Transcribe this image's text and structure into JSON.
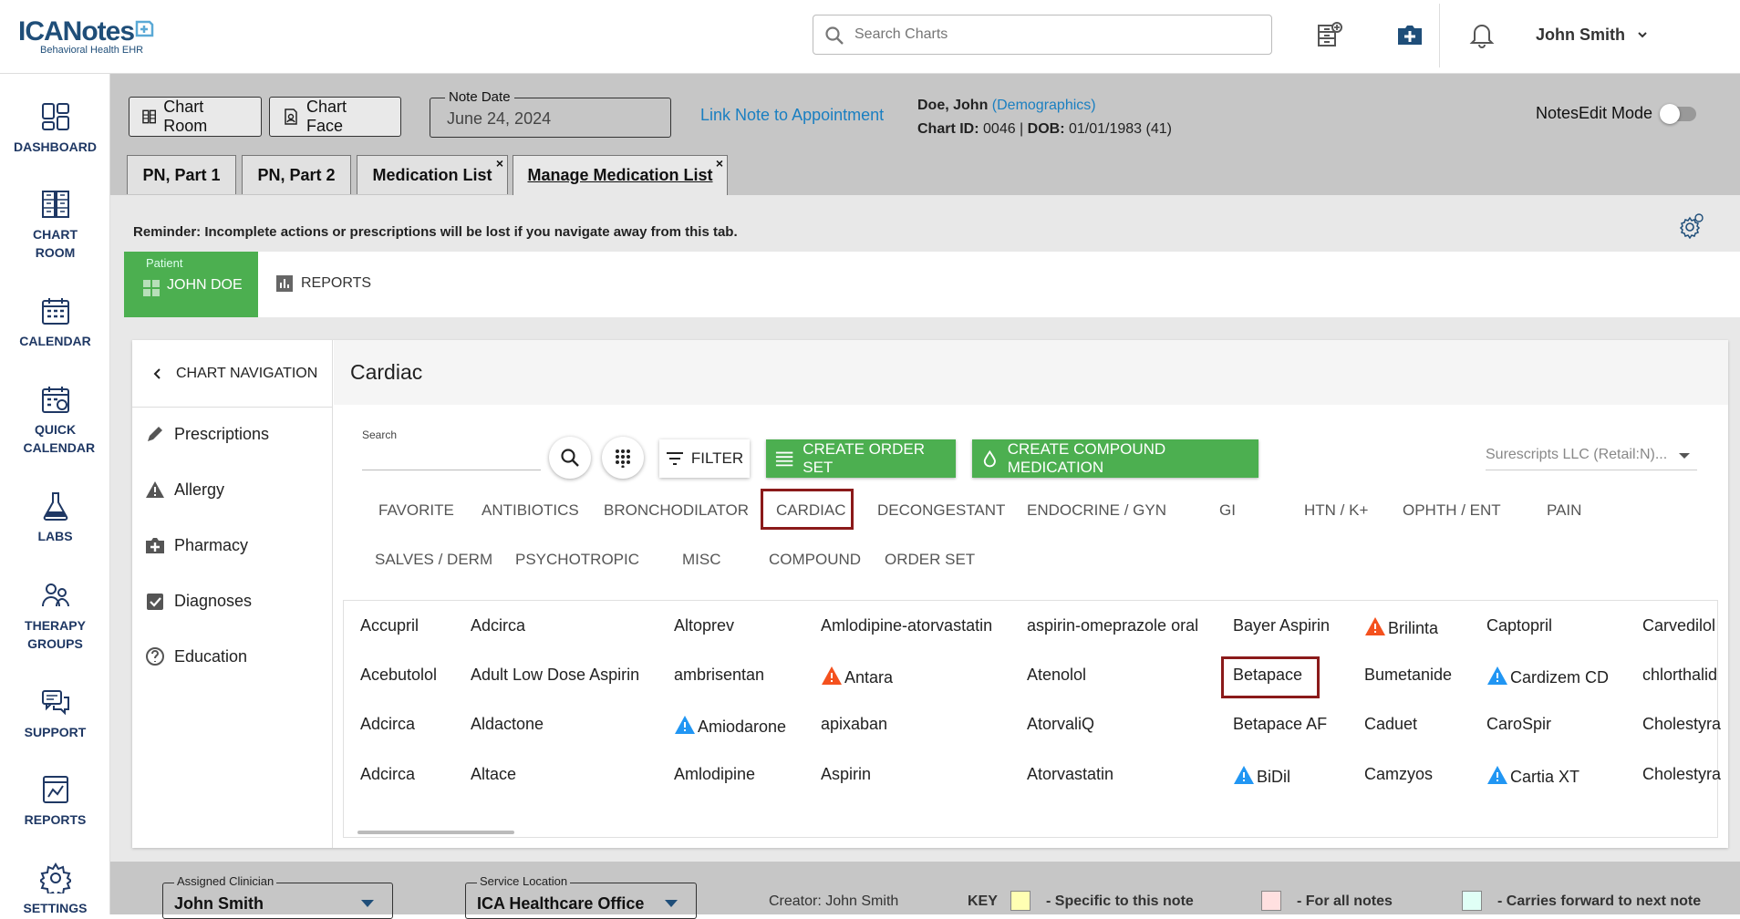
{
  "header": {
    "logo_main": "ICANotes",
    "logo_sub": "Behavioral Health EHR",
    "search_placeholder": "Search Charts",
    "user_name": "John Smith"
  },
  "sidebar": {
    "items": [
      {
        "label": "DASHBOARD"
      },
      {
        "label": "CHART ROOM"
      },
      {
        "label": "CALENDAR"
      },
      {
        "label": "QUICK CALENDAR"
      },
      {
        "label": "LABS"
      },
      {
        "label": "THERAPY GROUPS"
      },
      {
        "label": "SUPPORT"
      },
      {
        "label": "REPORTS"
      },
      {
        "label": "SETTINGS"
      }
    ]
  },
  "topbar": {
    "chart_room": "Chart Room",
    "chart_face": "Chart Face",
    "note_date_label": "Note Date",
    "note_date_value": "June 24, 2024",
    "link_note": "Link Note to Appointment",
    "patient_name": "Doe, John",
    "demographics": "(Demographics)",
    "chart_id_label": "Chart ID:",
    "chart_id": "0046",
    "dob_label": "DOB:",
    "dob": "01/01/1983 (41)",
    "notes_edit_mode": "NotesEdit Mode"
  },
  "tabs": [
    {
      "label": "PN, Part 1"
    },
    {
      "label": "PN, Part 2"
    },
    {
      "label": "Medication List",
      "close": "×"
    },
    {
      "label": "Manage Medication List",
      "close": "×"
    }
  ],
  "reminder": "Reminder: Incomplete actions or prescriptions will be lost if you navigate away from this tab.",
  "patient_tab": {
    "small": "Patient",
    "name": "JOHN DOE"
  },
  "reports_tab": "REPORTS",
  "chart_nav": {
    "header": "CHART NAVIGATION",
    "items": [
      {
        "label": "Prescriptions"
      },
      {
        "label": "Allergy"
      },
      {
        "label": "Pharmacy"
      },
      {
        "label": "Diagnoses"
      },
      {
        "label": "Education"
      }
    ]
  },
  "main": {
    "title": "Cardiac",
    "search_label": "Search",
    "filter_label": "FILTER",
    "create_order_set": "CREATE ORDER SET",
    "create_compound": "CREATE COMPOUND MEDICATION",
    "pharmacy_select": "Surescripts LLC (Retail:N)...",
    "categories_row1": [
      "FAVORITE",
      "ANTIBIOTICS",
      "BRONCHODILATOR",
      "CARDIAC",
      "DECONGESTANT",
      "ENDOCRINE / GYN",
      "GI",
      "HTN / K+",
      "OPHTH / ENT",
      "PAIN"
    ],
    "categories_row2": [
      "SALVES / DERM",
      "PSYCHOTROPIC",
      "MISC",
      "COMPOUND",
      "ORDER SET"
    ],
    "medications": [
      [
        "Accupril",
        "Adcirca",
        "Altoprev",
        "Amlodipine-atorvastatin",
        "aspirin-omeprazole oral",
        "Bayer Aspirin",
        "Brilinta",
        "Captopril",
        "Carvedilol"
      ],
      [
        "Acebutolol",
        "Adult Low Dose Aspirin",
        "ambrisentan",
        "Antara",
        "Atenolol",
        "Betapace",
        "Bumetanide",
        "Cardizem CD",
        "chlorthalid"
      ],
      [
        "Adcirca",
        "Aldactone",
        "Amiodarone",
        "apixaban",
        "AtorvaliQ",
        "Betapace AF",
        "Caduet",
        "CaroSpir",
        "Cholestyra"
      ],
      [
        "Adcirca",
        "Altace",
        "Amlodipine",
        "Aspirin",
        "Atorvastatin",
        "BiDil",
        "Camzyos",
        "Cartia XT",
        "Cholestyra"
      ]
    ]
  },
  "footer": {
    "assigned_clinician_label": "Assigned Clinician",
    "assigned_clinician": "John Smith",
    "service_location_label": "Service Location",
    "service_location": "ICA Healthcare Office",
    "creator": "Creator: John Smith",
    "key": "KEY",
    "key1": "- Specific to this note",
    "key2": "- For all notes",
    "key3": "- Carries forward to next note"
  },
  "colors": {
    "brand": "#1f4e79",
    "accent_green": "#4caf50",
    "link": "#1a7fc1",
    "highlight_box": "#8b1a1a",
    "warn_orange": "#f4511e",
    "warn_blue": "#2196f3"
  }
}
